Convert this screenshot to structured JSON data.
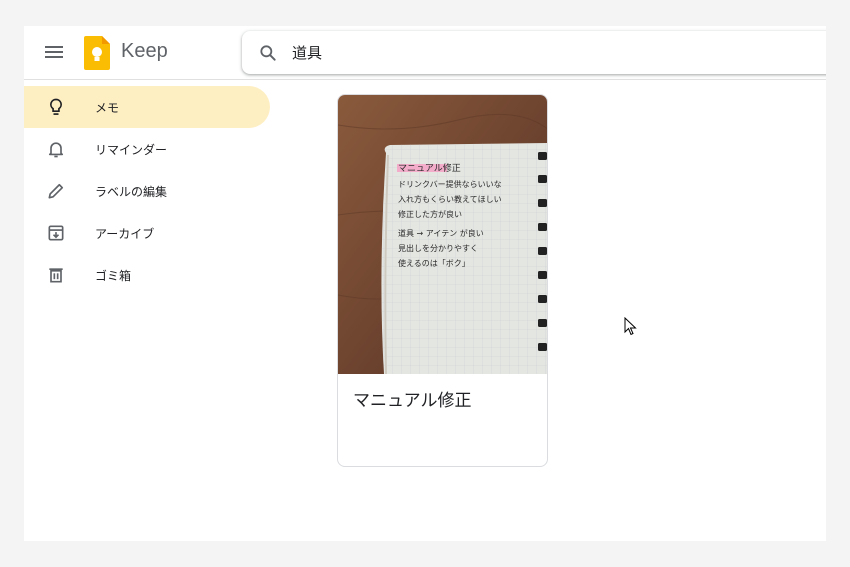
{
  "header": {
    "menu_icon": "hamburger-menu-icon",
    "logo_icon": "keep-logo-icon",
    "app_title": "Keep",
    "search": {
      "icon": "search-icon",
      "value": "道具"
    }
  },
  "sidebar": {
    "items": [
      {
        "label": "メモ",
        "icon": "lightbulb-icon",
        "active": true
      },
      {
        "label": "リマインダー",
        "icon": "bell-icon",
        "active": false
      },
      {
        "label": "ラベルの編集",
        "icon": "pencil-icon",
        "active": false
      },
      {
        "label": "アーカイブ",
        "icon": "archive-icon",
        "active": false
      },
      {
        "label": "ゴミ箱",
        "icon": "trash-icon",
        "active": false
      }
    ]
  },
  "notes": [
    {
      "title": "マニュアル修正",
      "image": {
        "highlight_line": "マニュアル修正",
        "handwritten_lines": [
          "ドリンクバー提供ならいいな",
          "入れ方もくらい教えてほしい",
          "修正した方が良い",
          "道具 → アイテン が良い",
          "見出しを分かりやすく",
          "使えるのは「ボク」"
        ]
      }
    }
  ],
  "colors": {
    "active_nav_bg": "#feefc3",
    "keep_yellow": "#fbbc04",
    "icon_gray": "#5f6368"
  }
}
